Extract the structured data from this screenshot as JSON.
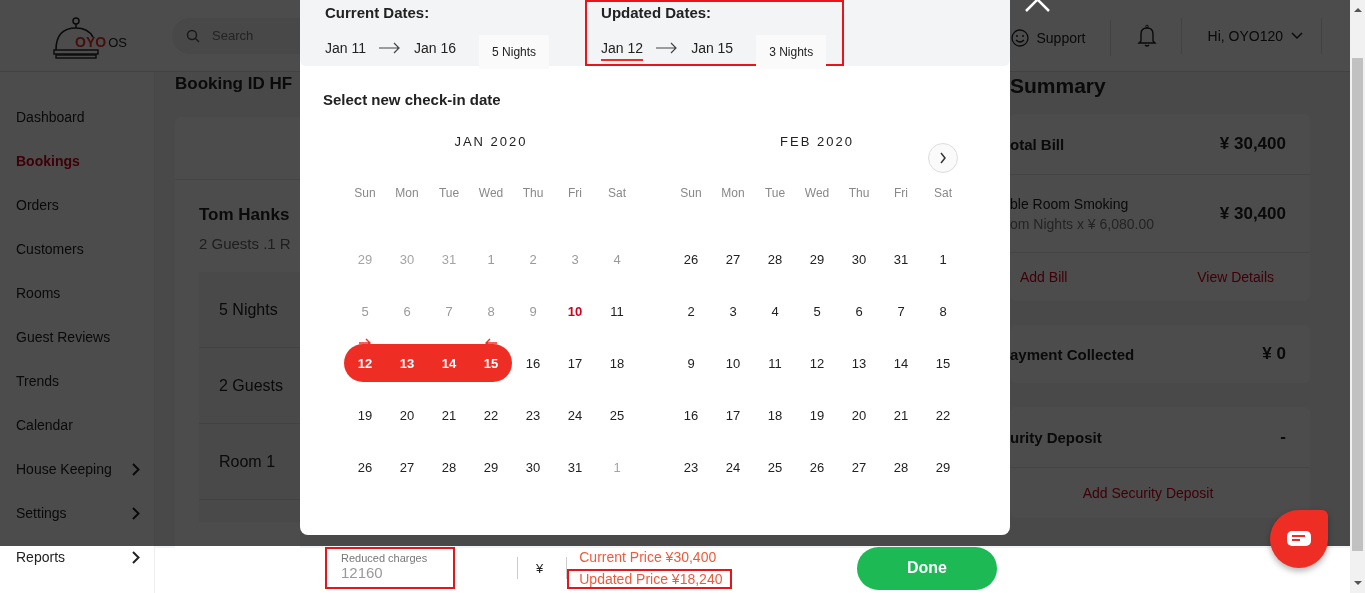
{
  "header": {
    "logo": {
      "brand": "OYO",
      "suffix": "OS"
    },
    "search": {
      "placeholder": "Search"
    },
    "support": "Support",
    "user": "Hi, OYO120"
  },
  "sidebar": {
    "items": [
      {
        "label": "Dashboard",
        "selected": false,
        "submenu": false
      },
      {
        "label": "Bookings",
        "selected": true,
        "submenu": false
      },
      {
        "label": "Orders",
        "selected": false,
        "submenu": false
      },
      {
        "label": "Customers",
        "selected": false,
        "submenu": false
      },
      {
        "label": "Rooms",
        "selected": false,
        "submenu": false
      },
      {
        "label": "Guest Reviews",
        "selected": false,
        "submenu": false
      },
      {
        "label": "Trends",
        "selected": false,
        "submenu": false
      },
      {
        "label": "Calendar",
        "selected": false,
        "submenu": false
      },
      {
        "label": "House Keeping",
        "selected": false,
        "submenu": true
      },
      {
        "label": "Settings",
        "selected": false,
        "submenu": true
      },
      {
        "label": "Reports",
        "selected": false,
        "submenu": true
      }
    ]
  },
  "booking": {
    "title": "Booking ID HF",
    "guest": "Tom Hanks",
    "summary_line": "2 Guests .1 R",
    "rows": [
      "5 Nights",
      "2 Guests",
      "Room 1"
    ]
  },
  "summary": {
    "title": "Summary",
    "total": {
      "label": "otal Bill",
      "amount": "¥ 30,400"
    },
    "line": {
      "name": "ble Room Smoking",
      "detail": "om Nights x ¥ 6,080.00",
      "amount": "¥ 30,400"
    },
    "actions": [
      "Add Bill",
      "View Details"
    ],
    "payment": {
      "label": "ayment Collected",
      "amount": "¥ 0"
    },
    "deposit": {
      "label": "urity Deposit",
      "amount": "-",
      "action": "Add Security Deposit"
    }
  },
  "modal": {
    "current": {
      "label": "Current Dates:",
      "from": "Jan 11",
      "to": "Jan 16",
      "nights": "5 Nights"
    },
    "updated": {
      "label": "Updated Dates:",
      "from": "Jan 12",
      "to": "Jan 15",
      "nights": "3 Nights",
      "highlighted": true
    },
    "prompt": "Select new check-in date",
    "months": [
      {
        "title": "JAN 2020",
        "weekdays": [
          "Sun",
          "Mon",
          "Tue",
          "Wed",
          "Thu",
          "Fri",
          "Sat"
        ],
        "weeks": [
          [
            {
              "d": "29",
              "kind": "outside"
            },
            {
              "d": "30",
              "kind": "outside"
            },
            {
              "d": "31",
              "kind": "outside"
            },
            {
              "d": "1",
              "kind": "past"
            },
            {
              "d": "2",
              "kind": "past"
            },
            {
              "d": "3",
              "kind": "past"
            },
            {
              "d": "4",
              "kind": "past"
            }
          ],
          [
            {
              "d": "5",
              "kind": "past"
            },
            {
              "d": "6",
              "kind": "past"
            },
            {
              "d": "7",
              "kind": "past"
            },
            {
              "d": "8",
              "kind": "past"
            },
            {
              "d": "9",
              "kind": "past"
            },
            {
              "d": "10",
              "kind": "today"
            },
            {
              "d": "11",
              "kind": "normal"
            }
          ],
          [
            {
              "d": "12",
              "kind": "start"
            },
            {
              "d": "13",
              "kind": "mid"
            },
            {
              "d": "14",
              "kind": "mid"
            },
            {
              "d": "15",
              "kind": "end"
            },
            {
              "d": "16",
              "kind": "normal"
            },
            {
              "d": "17",
              "kind": "normal"
            },
            {
              "d": "18",
              "kind": "normal"
            }
          ],
          [
            {
              "d": "19",
              "kind": "normal"
            },
            {
              "d": "20",
              "kind": "normal"
            },
            {
              "d": "21",
              "kind": "normal"
            },
            {
              "d": "22",
              "kind": "normal"
            },
            {
              "d": "23",
              "kind": "normal"
            },
            {
              "d": "24",
              "kind": "normal"
            },
            {
              "d": "25",
              "kind": "normal"
            }
          ],
          [
            {
              "d": "26",
              "kind": "normal"
            },
            {
              "d": "27",
              "kind": "normal"
            },
            {
              "d": "28",
              "kind": "normal"
            },
            {
              "d": "29",
              "kind": "normal"
            },
            {
              "d": "30",
              "kind": "normal"
            },
            {
              "d": "31",
              "kind": "normal"
            },
            {
              "d": "1",
              "kind": "outside"
            }
          ]
        ]
      },
      {
        "title": "FEB 2020",
        "weekdays": [
          "Sun",
          "Mon",
          "Tue",
          "Wed",
          "Thu",
          "Fri",
          "Sat"
        ],
        "weeks": [
          [
            {
              "d": "26",
              "kind": "normal"
            },
            {
              "d": "27",
              "kind": "normal"
            },
            {
              "d": "28",
              "kind": "normal"
            },
            {
              "d": "29",
              "kind": "normal"
            },
            {
              "d": "30",
              "kind": "normal"
            },
            {
              "d": "31",
              "kind": "normal"
            },
            {
              "d": "1",
              "kind": "normal"
            }
          ],
          [
            {
              "d": "2",
              "kind": "normal"
            },
            {
              "d": "3",
              "kind": "normal"
            },
            {
              "d": "4",
              "kind": "normal"
            },
            {
              "d": "5",
              "kind": "normal"
            },
            {
              "d": "6",
              "kind": "normal"
            },
            {
              "d": "7",
              "kind": "normal"
            },
            {
              "d": "8",
              "kind": "normal"
            }
          ],
          [
            {
              "d": "9",
              "kind": "normal"
            },
            {
              "d": "10",
              "kind": "normal"
            },
            {
              "d": "11",
              "kind": "normal"
            },
            {
              "d": "12",
              "kind": "normal"
            },
            {
              "d": "13",
              "kind": "normal"
            },
            {
              "d": "14",
              "kind": "normal"
            },
            {
              "d": "15",
              "kind": "normal"
            }
          ],
          [
            {
              "d": "16",
              "kind": "normal"
            },
            {
              "d": "17",
              "kind": "normal"
            },
            {
              "d": "18",
              "kind": "normal"
            },
            {
              "d": "19",
              "kind": "normal"
            },
            {
              "d": "20",
              "kind": "normal"
            },
            {
              "d": "21",
              "kind": "normal"
            },
            {
              "d": "22",
              "kind": "normal"
            }
          ],
          [
            {
              "d": "23",
              "kind": "normal"
            },
            {
              "d": "24",
              "kind": "normal"
            },
            {
              "d": "25",
              "kind": "normal"
            },
            {
              "d": "26",
              "kind": "normal"
            },
            {
              "d": "27",
              "kind": "normal"
            },
            {
              "d": "28",
              "kind": "normal"
            },
            {
              "d": "29",
              "kind": "normal"
            }
          ]
        ]
      }
    ]
  },
  "footer": {
    "reduced": {
      "label": "Reduced charges",
      "value": "12160",
      "highlighted": true
    },
    "currency": "¥",
    "current_price": {
      "text": "Current Price  ¥30,400"
    },
    "updated_price": {
      "text": "Updated Price  ¥18,240",
      "highlighted": true
    },
    "done": "Done"
  }
}
